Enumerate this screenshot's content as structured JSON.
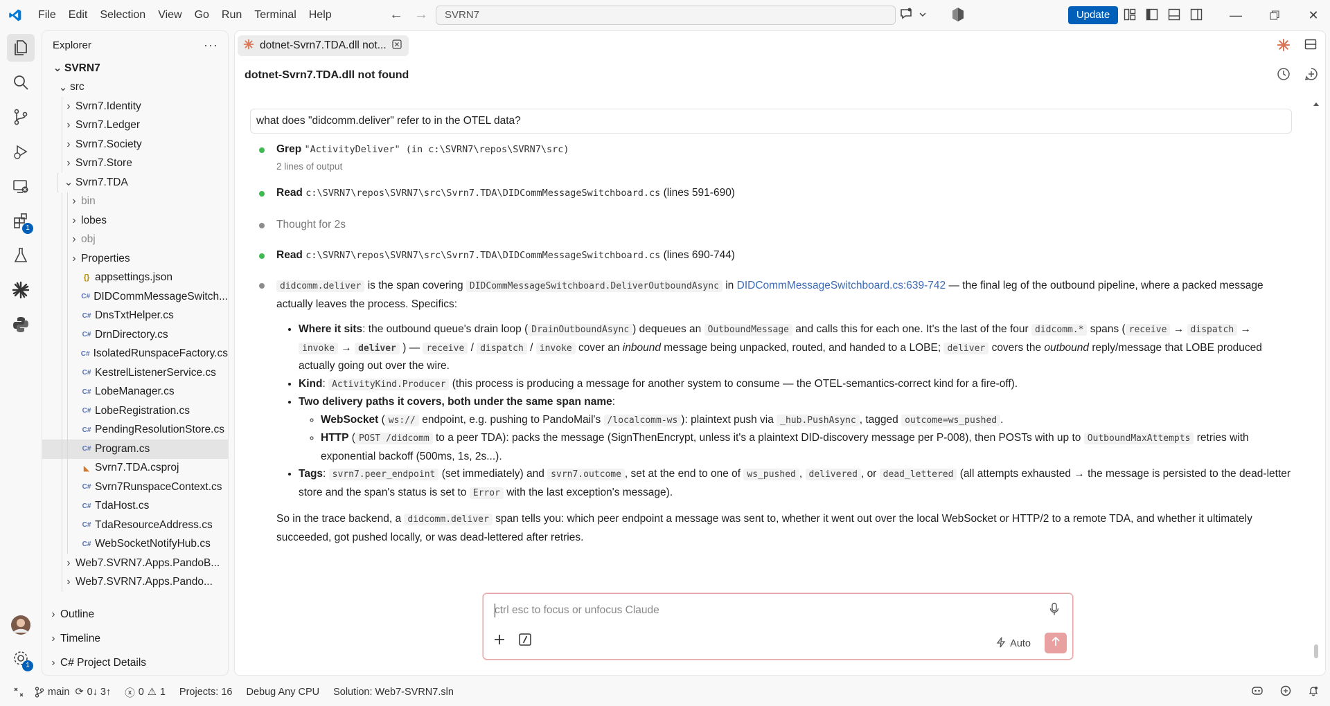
{
  "menu": [
    "File",
    "Edit",
    "Selection",
    "View",
    "Go",
    "Run",
    "Terminal",
    "Help"
  ],
  "command_center": "SVRN7",
  "update_label": "Update",
  "activity_badges": {
    "extensions": "1",
    "manage": "1"
  },
  "sidebar": {
    "title": "Explorer",
    "root": "SVRN7",
    "src": "src",
    "folders": [
      "Svrn7.Identity",
      "Svrn7.Ledger",
      "Svrn7.Society",
      "Svrn7.Store"
    ],
    "tda": "Svrn7.TDA",
    "tda_folders": [
      "bin",
      "lobes",
      "obj",
      "Properties"
    ],
    "files": [
      {
        "name": "appsettings.json",
        "kind": "json"
      },
      {
        "name": "DIDCommMessageSwitch...",
        "kind": "cs"
      },
      {
        "name": "DnsTxtHelper.cs",
        "kind": "cs"
      },
      {
        "name": "DrnDirectory.cs",
        "kind": "cs"
      },
      {
        "name": "IsolatedRunspaceFactory.cs",
        "kind": "cs"
      },
      {
        "name": "KestrelListenerService.cs",
        "kind": "cs"
      },
      {
        "name": "LobeManager.cs",
        "kind": "cs"
      },
      {
        "name": "LobeRegistration.cs",
        "kind": "cs"
      },
      {
        "name": "PendingResolutionStore.cs",
        "kind": "cs"
      },
      {
        "name": "Program.cs",
        "kind": "cs"
      },
      {
        "name": "Svrn7.TDA.csproj",
        "kind": "rss"
      },
      {
        "name": "Svrn7RunspaceContext.cs",
        "kind": "cs"
      },
      {
        "name": "TdaHost.cs",
        "kind": "cs"
      },
      {
        "name": "TdaResourceAddress.cs",
        "kind": "cs"
      },
      {
        "name": "WebSocketNotifyHub.cs",
        "kind": "cs"
      }
    ],
    "bottom_folders": [
      "Web7.SVRN7.Apps.PandoB...",
      "Web7.SVRN7.Apps.Pando..."
    ],
    "sections": [
      "Outline",
      "Timeline",
      "C# Project Details"
    ]
  },
  "tab": {
    "label": "dotnet-Svrn7.TDA.dll not..."
  },
  "chat": {
    "title": "dotnet-Svrn7.TDA.dll not found",
    "question": "what does \"didcomm.deliver\" refer to in the OTEL data?",
    "steps": {
      "grep_label": "Grep",
      "grep_text": "\"ActivityDeliver\" (in c:\\SVRN7\\repos\\SVRN7\\src)",
      "grep_sub": "2 lines of output",
      "read1_label": "Read",
      "read1_path": "c:\\SVRN7\\repos\\SVRN7\\src\\Svrn7.TDA\\DIDCommMessageSwitchboard.cs",
      "read1_lines": "(lines 591-690)",
      "thought": "Thought for 2s",
      "read2_label": "Read",
      "read2_path": "c:\\SVRN7\\repos\\SVRN7\\src\\Svrn7.TDA\\DIDCommMessageSwitchboard.cs",
      "read2_lines": "(lines 690-744)"
    },
    "answer": {
      "c_deliver": "didcomm.deliver",
      "t_is_span": "is the span covering",
      "c_method": "DIDCommMessageSwitchboard.DeliverOutboundAsync",
      "t_in": "in",
      "link": "DIDCommMessageSwitchboard.cs:639-742",
      "t_final": "— the final leg of the outbound pipeline, where a packed message actually leaves the process. Specifics:",
      "b1_label": "Where it sits",
      "b1_t1": ": the outbound queue's drain loop (",
      "b1_c1": "DrainOutboundAsync",
      "b1_t2": ") dequeues an",
      "b1_c2": "OutboundMessage",
      "b1_t3": "and calls this for each one. It's the last of the four",
      "b1_c3": "didcomm.*",
      "b1_t4": "spans (",
      "b1_c4": "receive",
      "b1_c5": "dispatch",
      "b1_c6": "invoke",
      "b1_c7": "deliver",
      "b1_t5": ") —",
      "b1_t6": "cover an",
      "b1_i1": "inbound",
      "b1_t7": "message being unpacked, routed, and handed to a LOBE;",
      "b1_c8": "deliver",
      "b1_t8": "covers the",
      "b1_i2": "outbound",
      "b1_t9": "reply/message that LOBE produced actually going out over the wire.",
      "b2_label": "Kind",
      "b2_c1": "ActivityKind.Producer",
      "b2_t1": "(this process is producing a message for another system to consume — the OTEL-semantics-correct kind for a fire-off).",
      "b3_label": "Two delivery paths it covers, both under the same span name",
      "b3a_label": "WebSocket",
      "b3a_c1": "ws://",
      "b3a_t1": "endpoint, e.g. pushing to PandoMail's",
      "b3a_c2": "/localcomm-ws",
      "b3a_t2": "): plaintext push via",
      "b3a_c3": "_hub.PushAsync",
      "b3a_t3": ", tagged",
      "b3a_c4": "outcome=ws_pushed",
      "b3b_label": "HTTP",
      "b3b_c1": "POST /didcomm",
      "b3b_t1": "to a peer TDA): packs the message (SignThenEncrypt, unless it's a plaintext DID-discovery message per P-008), then POSTs with up to",
      "b3b_c2": "OutboundMaxAttempts",
      "b3b_t2": "retries with exponential backoff (500ms, 1s, 2s...).",
      "b4_label": "Tags",
      "b4_c1": "svrn7.peer_endpoint",
      "b4_t1": "(set immediately) and",
      "b4_c2": "svrn7.outcome",
      "b4_t2": ", set at the end to one of",
      "b4_c3": "ws_pushed",
      "b4_c4": "delivered",
      "b4_t3": ", or",
      "b4_c5": "dead_lettered",
      "b4_t4": "(all attempts exhausted → the message is persisted to the dead-letter store and the span's status is set to",
      "b4_c6": "Error",
      "b4_t5": "with the last exception's message).",
      "p_t1": "So in the trace backend, a",
      "p_c1": "didcomm.deliver",
      "p_t2": "span tells you: which peer endpoint a message was sent to, whether it went out over the local WebSocket or HTTP/2 to a remote TDA, and whether it ultimately succeeded, got pushed locally, or was dead-lettered after retries."
    },
    "input_placeholder": "ctrl esc to focus or unfocus Claude",
    "mode_label": "Auto"
  },
  "status": {
    "branch": "main",
    "sync": "0↓ 3↑",
    "errors": "0",
    "warnings": "1",
    "projects": "Projects: 16",
    "config": "Debug Any CPU",
    "solution": "Solution: Web7-SVRN7.sln"
  }
}
